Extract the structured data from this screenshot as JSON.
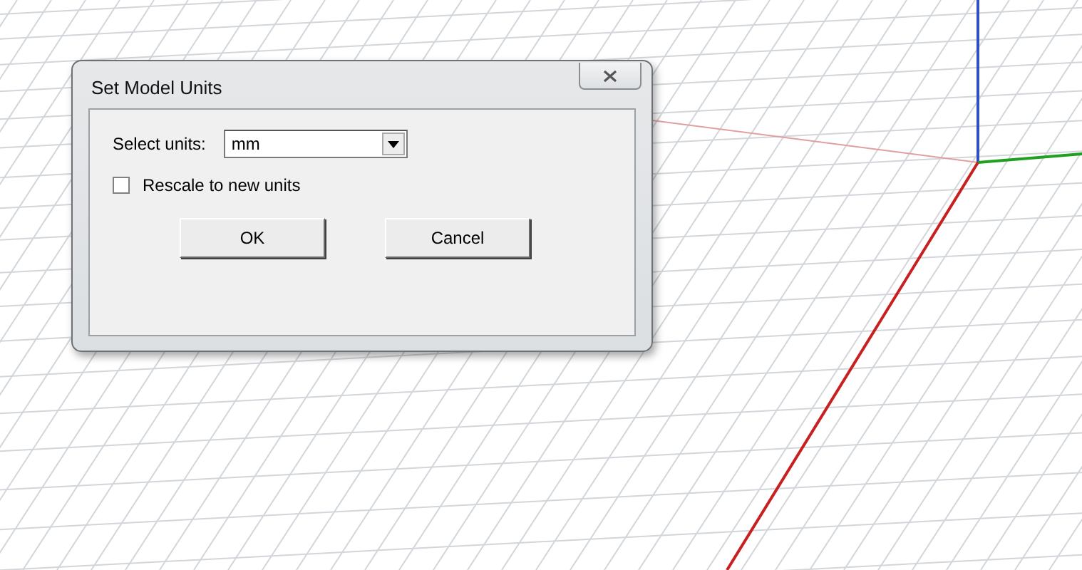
{
  "dialog": {
    "title": "Set Model Units",
    "units": {
      "label": "Select units:",
      "value": "mm"
    },
    "rescale": {
      "label": "Rescale to new units",
      "checked": false
    },
    "buttons": [
      {
        "label": "OK"
      },
      {
        "label": "Cancel"
      }
    ]
  }
}
